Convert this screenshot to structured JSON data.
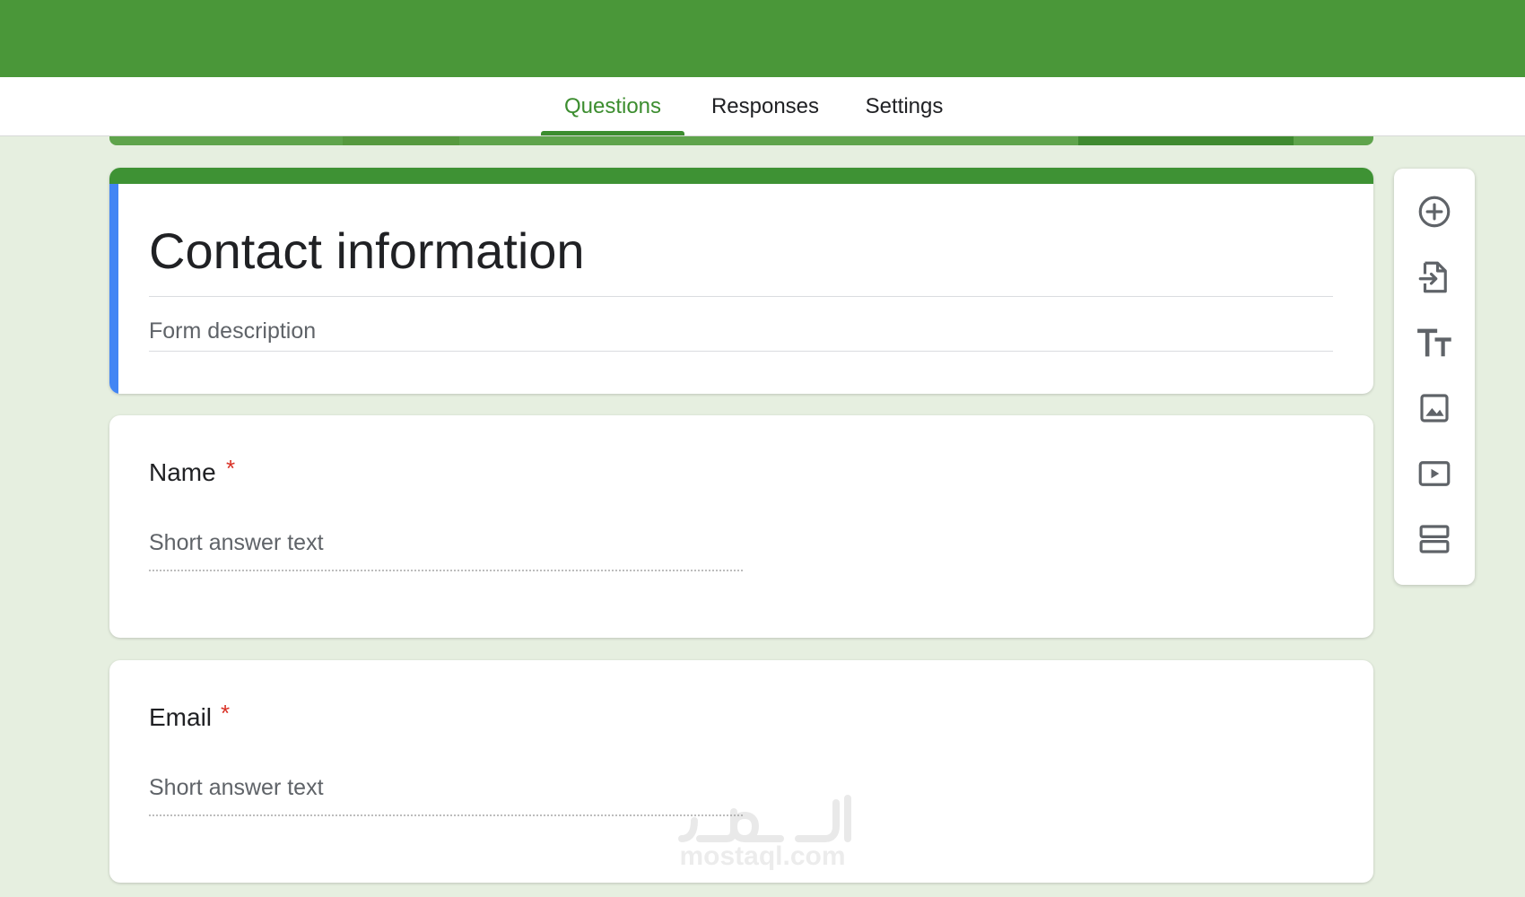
{
  "tabs": [
    {
      "label": "Questions",
      "active": true
    },
    {
      "label": "Responses",
      "active": false
    },
    {
      "label": "Settings",
      "active": false
    }
  ],
  "form": {
    "title": "Contact information",
    "description_placeholder": "Form description"
  },
  "questions": [
    {
      "label": "Name",
      "required_mark": "*",
      "placeholder": "Short answer text"
    },
    {
      "label": "Email",
      "required_mark": "*",
      "placeholder": "Short answer text"
    }
  ],
  "toolbar": [
    {
      "icon": "add-circle-icon"
    },
    {
      "icon": "import-questions-icon"
    },
    {
      "icon": "title-text-icon"
    },
    {
      "icon": "image-icon"
    },
    {
      "icon": "video-icon"
    },
    {
      "icon": "section-icon"
    }
  ],
  "watermark": {
    "text": "mostaql.com"
  },
  "colors": {
    "header_green": "#4a9739",
    "accent_green": "#3c8d2f",
    "accent_blue": "#4285f4",
    "required_red": "#d93025",
    "page_background": "#e6efe0"
  }
}
